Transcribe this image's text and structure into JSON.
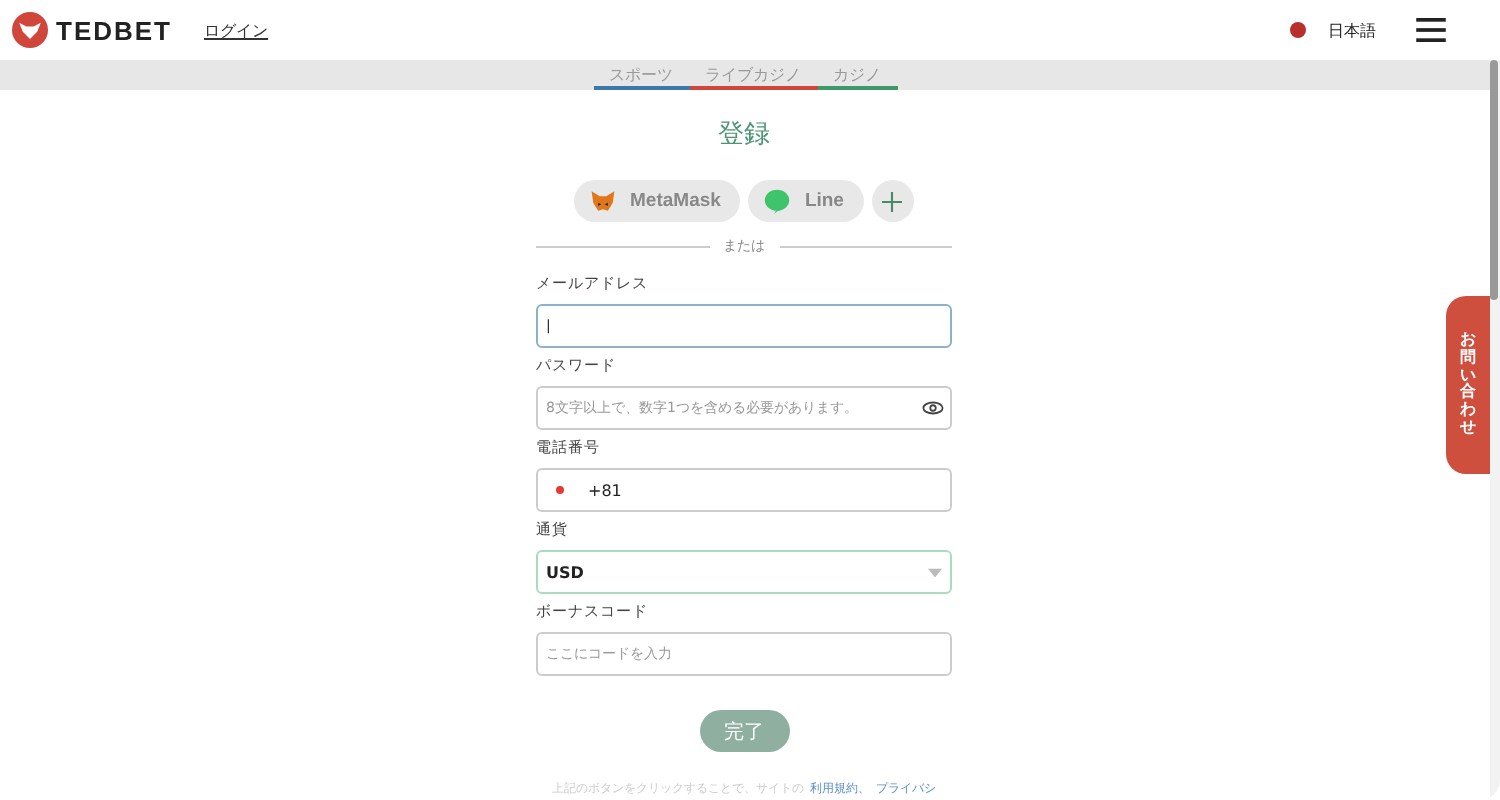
{
  "header": {
    "logo": "TEDBET",
    "login_link": "ログイン",
    "language": "日本語"
  },
  "nav_tabs": [
    {
      "label": "スポーツ",
      "color": "#3a79a8"
    },
    {
      "label": "ライブカジノ",
      "color": "#d0463b"
    },
    {
      "label": "カジノ",
      "color": "#3e9a6b"
    }
  ],
  "title": "登録",
  "social_buttons": [
    {
      "kind": "metamask",
      "label": "MetaMask"
    },
    {
      "kind": "line",
      "label": "Line"
    },
    {
      "kind": "more"
    }
  ],
  "divider_text": "または",
  "fields": [
    {
      "kind": "text",
      "label": "メールアドレス",
      "value": "|",
      "focused": true
    },
    {
      "kind": "password",
      "label": "パスワード",
      "placeholder": "8文字以上で、数字1つを含める必要があります。"
    },
    {
      "kind": "phone",
      "label": "電話番号",
      "value": "+81"
    },
    {
      "kind": "select",
      "label": "通貨",
      "value": "USD"
    },
    {
      "kind": "text",
      "label": "ボーナスコード",
      "placeholder": "ここにコードを入力",
      "focused": false
    }
  ],
  "submit_button": "完了",
  "terms": {
    "text": "上記のボタンをクリックすることで、サイトの",
    "links": [
      "利用規約、",
      "プライバシ"
    ]
  },
  "contact_tab": "お問い合わせ"
}
